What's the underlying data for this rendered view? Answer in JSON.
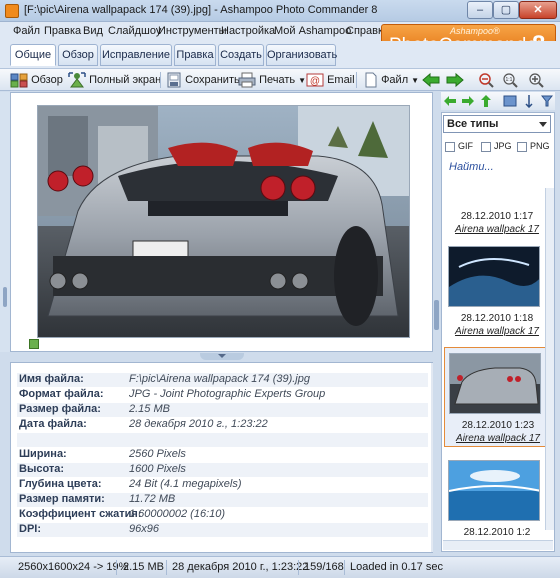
{
  "window": {
    "title": "[F:\\pic\\Airena wallpapack 174 (39).jpg] - Ashampoo Photo Commander 8",
    "minimize": "‒",
    "maximize": "▢",
    "close": "✕"
  },
  "logo": {
    "small": "Ashampoo®",
    "main": "PhotoCommander",
    "version": "8"
  },
  "menu": [
    "Файл",
    "Правка",
    "Вид",
    "Слайдшоу",
    "Инструменты",
    "Настройка",
    "Мой Ashampoo",
    "Справка"
  ],
  "tabs": [
    "Общие",
    "Обзор",
    "Исправление",
    "Правка",
    "Создать",
    "Организовать"
  ],
  "toolbar": {
    "overview": "Обзор",
    "fullscreen": "Полный экран",
    "save": "Сохранить",
    "print": "Печать",
    "email": "Email",
    "file": "Файл"
  },
  "colors": {
    "accent": "#e8801c",
    "panel_border": "#a2b6d1",
    "link": "#2b4f9e"
  },
  "info": [
    {
      "label": "Имя файла:",
      "value": "F:\\pic\\Airena wallpapack 174 (39).jpg"
    },
    {
      "label": "Формат файла:",
      "value": "JPG - Joint Photographic Experts Group"
    },
    {
      "label": "Размер файла:",
      "value": "2.15 MB"
    },
    {
      "label": "Дата файла:",
      "value": "28 декабря 2010 г., 1:23:22"
    },
    {
      "label": "",
      "value": ""
    },
    {
      "label": "Ширина:",
      "value": "2560 Pixels"
    },
    {
      "label": "Высота:",
      "value": "1600 Pixels"
    },
    {
      "label": "Глубина цвета:",
      "value": "24 Bit (4.1 megapixels)"
    },
    {
      "label": "Размер памяти:",
      "value": "11.72 MB"
    },
    {
      "label": "Коэффициент сжатия:",
      "value": "1.60000002 (16:10)"
    },
    {
      "label": "DPI:",
      "value": "96x96"
    }
  ],
  "filter": {
    "type_label": "Все типы",
    "gif": "GIF",
    "jpg": "JPG",
    "png": "PNG",
    "find": "Найти..."
  },
  "thumbnails": [
    {
      "date": "28.12.2010 1:17",
      "name": "Airena wallpack 17"
    },
    {
      "date": "28.12.2010 1:18",
      "name": "Airena wallpack 17"
    },
    {
      "date": "28.12.2010 1:23",
      "name": "Airena wallpack 17"
    },
    {
      "date": "28.12.2010 1:2",
      "name": ""
    }
  ],
  "status": {
    "dimensions": "2560x1600x24 -> 19%",
    "size": "2.15 MB",
    "date": "28 декабря 2010 г., 1:23:22",
    "position": "159/168",
    "loaded": "Loaded in 0.17 sec"
  }
}
